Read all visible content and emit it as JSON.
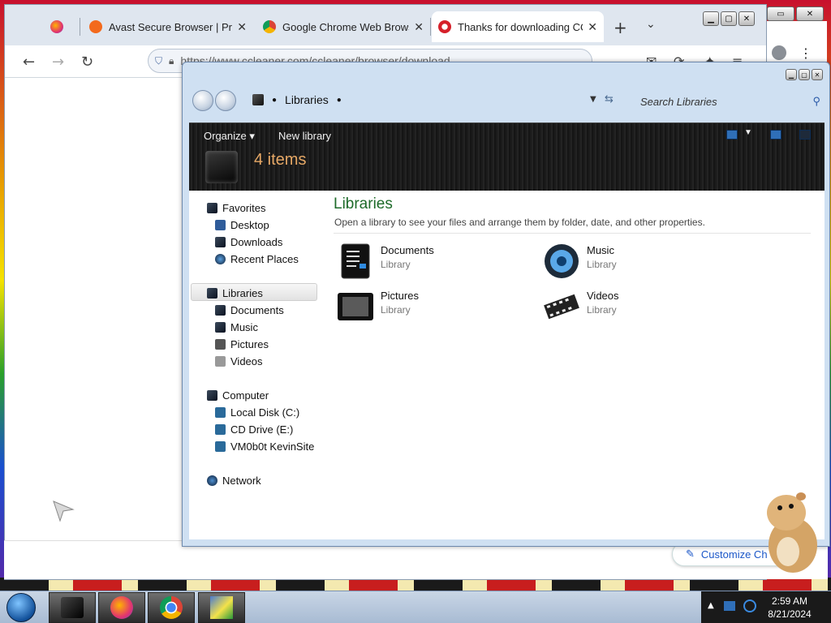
{
  "browser": {
    "tabs": [
      {
        "title": "",
        "favicon": "firefox-icon"
      },
      {
        "title": "Avast Secure Browser | Private",
        "favicon": "avast-icon"
      },
      {
        "title": "Google Chrome Web Browser",
        "favicon": "chrome-icon"
      },
      {
        "title": "Thanks for downloading CCle",
        "favicon": "ccleaner-icon",
        "active": true
      }
    ],
    "new_tab": "+",
    "tab_list": "⌄",
    "url": "https://www.ccleaner.com/ccleaner/browser/download",
    "customize_label": "Customize Ch"
  },
  "explorer": {
    "breadcrumb": "Libraries",
    "search_placeholder": "Search Libraries",
    "commands": {
      "organize": "Organize",
      "new_library": "New library"
    },
    "item_count": "4 items",
    "nav": {
      "favorites": {
        "label": "Favorites",
        "items": [
          "Desktop",
          "Downloads",
          "Recent Places"
        ]
      },
      "libraries": {
        "label": "Libraries",
        "items": [
          "Documents",
          "Music",
          "Pictures",
          "Videos"
        ]
      },
      "computer": {
        "label": "Computer",
        "items": [
          "Local Disk (C:)",
          "CD Drive (E:)",
          "VM0b0t KevinSite"
        ]
      },
      "network": "Network"
    },
    "content": {
      "title": "Libraries",
      "subtitle": "Open a library to see your files and arrange them by folder, date, and other properties.",
      "libraries": [
        {
          "name": "Documents",
          "type": "Library",
          "icon": "documents-icon"
        },
        {
          "name": "Music",
          "type": "Library",
          "icon": "music-speaker-icon"
        },
        {
          "name": "Pictures",
          "type": "Library",
          "icon": "pictures-icon"
        },
        {
          "name": "Videos",
          "type": "Library",
          "icon": "film-strip-icon"
        }
      ]
    }
  },
  "taskbar": {
    "time": "2:59 AM",
    "date": "8/21/2024",
    "apps": [
      "libraries-icon",
      "firefox-icon",
      "chrome-icon",
      "installer-icon"
    ]
  },
  "colors": {
    "accent_green": "#1e6b2a",
    "count_orange": "#e6a866",
    "link_blue": "#1a56c8"
  }
}
